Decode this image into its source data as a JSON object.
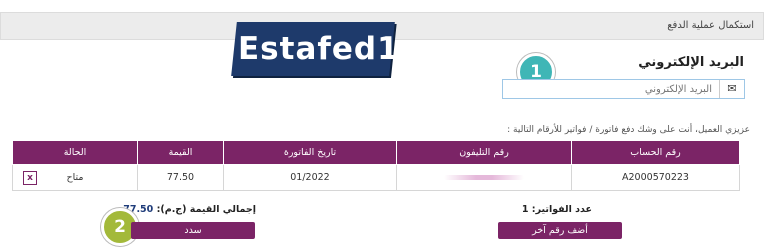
{
  "header": {
    "title": "استكمال عملية الدفع"
  },
  "logo": {
    "text": "Estafed1"
  },
  "email": {
    "section_title": "البريد الإلكتروني",
    "placeholder": "البريد الإلكتروني",
    "icon": "envelope-icon"
  },
  "steps": {
    "step1": "1",
    "step2": "2"
  },
  "notice": "عزيزي العميل، أنت على وشك دفع فاتورة / فواتير للأرقام التالية :",
  "table": {
    "headers": {
      "account": "رقم الحساب",
      "phone": "رقم التليفون",
      "date": "تاريخ الفاتورة",
      "amount": "القيمة",
      "status": "الحالة"
    },
    "rows": [
      {
        "account": "A2000570223",
        "phone": "",
        "date": "01/2022",
        "amount": "77.50",
        "status": "متاح",
        "remove": "x"
      }
    ]
  },
  "summary": {
    "count_label": "عدد الفواتير: 1",
    "total_label": "إجمالي القيمة (ج.م):",
    "total_value": "77.50"
  },
  "actions": {
    "pay": "سدد",
    "add_another": "أضف رقم آخر"
  },
  "colors": {
    "accent": "#7b2466",
    "logo_bg": "#1e3a6b",
    "step1": "#3fb6b6",
    "step2": "#a3b93a"
  }
}
